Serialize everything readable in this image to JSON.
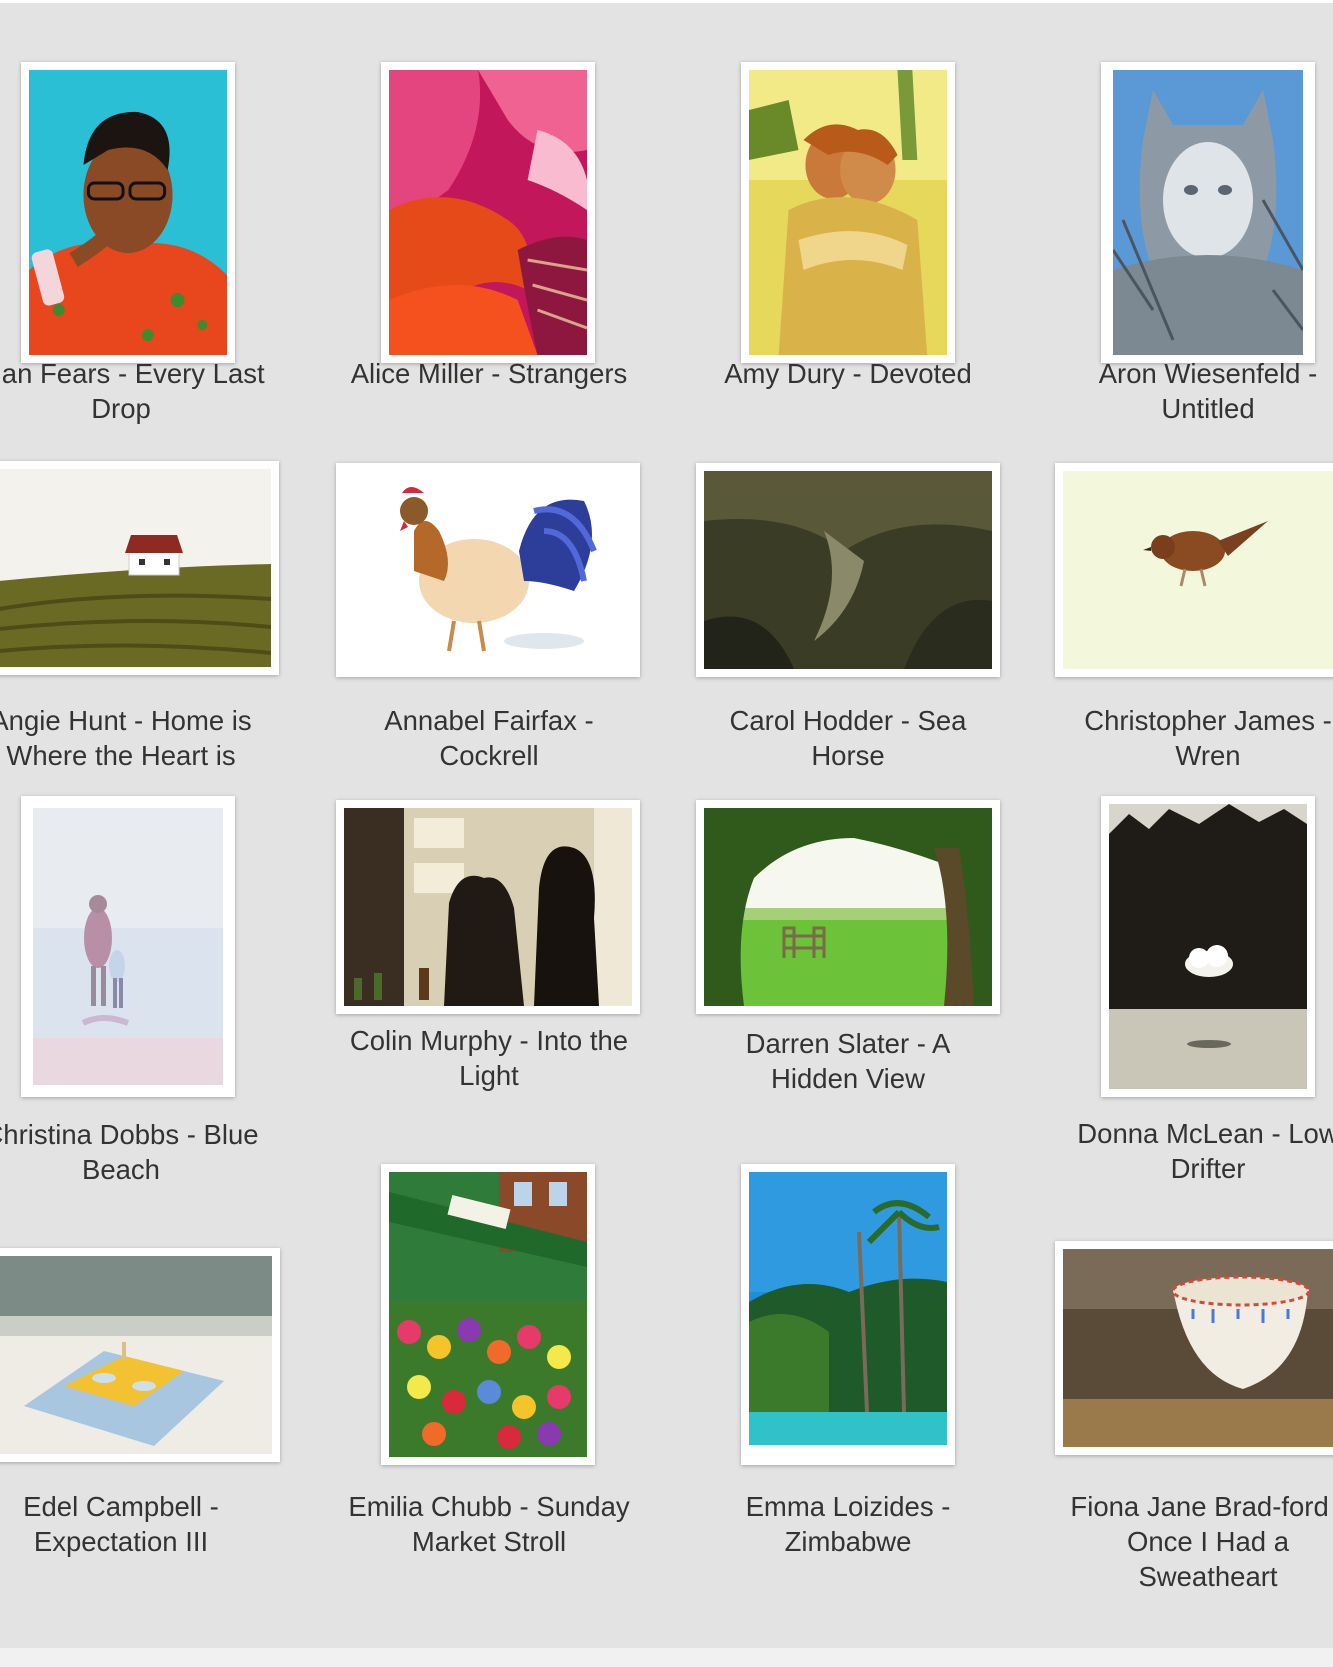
{
  "gallery": {
    "items": [
      {
        "artist_title": "Alan Fears - Every Last Drop"
      },
      {
        "artist_title": "Alice Miller - Strangers"
      },
      {
        "artist_title": "Amy Dury - Devoted"
      },
      {
        "artist_title": "Aron Wiesenfeld - Untitled"
      },
      {
        "artist_title": "Angie Hunt - Home is Where the Heart is"
      },
      {
        "artist_title": "Annabel Fairfax - Cockrell"
      },
      {
        "artist_title": "Carol Hodder - Sea Horse"
      },
      {
        "artist_title": "Christopher James - Wren"
      },
      {
        "artist_title": "Christina Dobbs - Blue Beach"
      },
      {
        "artist_title": "Colin Murphy - Into the Light"
      },
      {
        "artist_title": "Darren Slater - A Hidden View"
      },
      {
        "artist_title": "Donna McLean - Low Drifter"
      },
      {
        "artist_title": "Edel Campbell - Expectation III"
      },
      {
        "artist_title": "Emilia Chubb - Sunday Market Stroll"
      },
      {
        "artist_title": "Emma Loizides - Zimbabwe"
      },
      {
        "artist_title": "Fiona Jane Brad-ford - Once I Had a Sweatheart"
      }
    ]
  }
}
